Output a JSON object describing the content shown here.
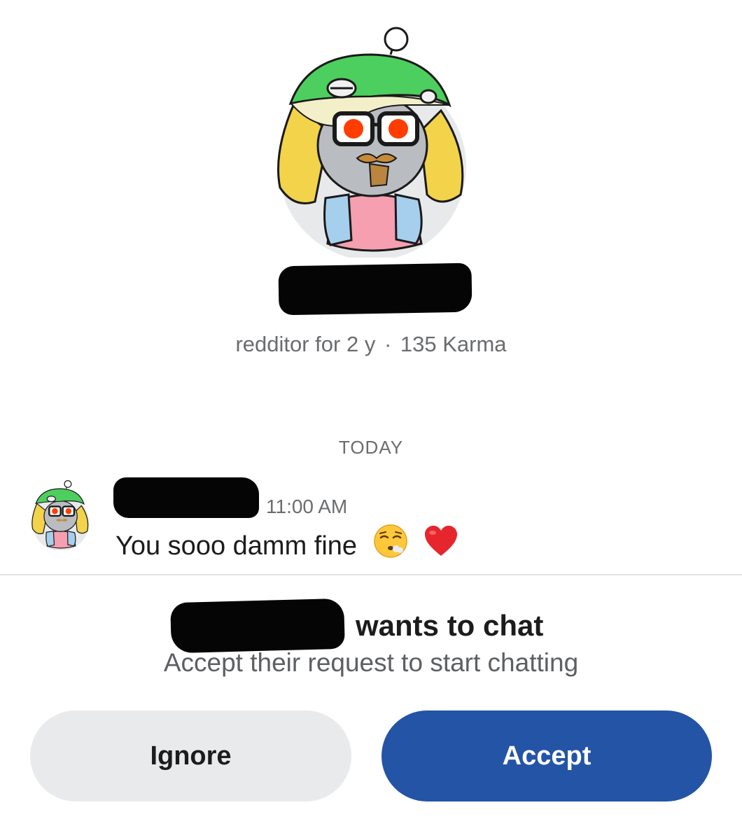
{
  "profile": {
    "account_age": "redditor for 2 y",
    "separator": "·",
    "karma": "135 Karma"
  },
  "conversation": {
    "day_label": "TODAY",
    "messages": [
      {
        "time": "11:00 AM",
        "text": "You sooo damm fine",
        "emojis": [
          "face-exhaling-emoji",
          "red-heart-emoji"
        ]
      }
    ]
  },
  "request": {
    "title": "wants to chat",
    "subtitle": "Accept their request to start chatting",
    "ignore_label": "Ignore",
    "accept_label": "Accept"
  },
  "colors": {
    "accept_button": "#2454a6",
    "ignore_button": "#e9eaec",
    "snoo_hat_green": "#4ccf5e",
    "snoo_eyes": "#ff3d00"
  }
}
